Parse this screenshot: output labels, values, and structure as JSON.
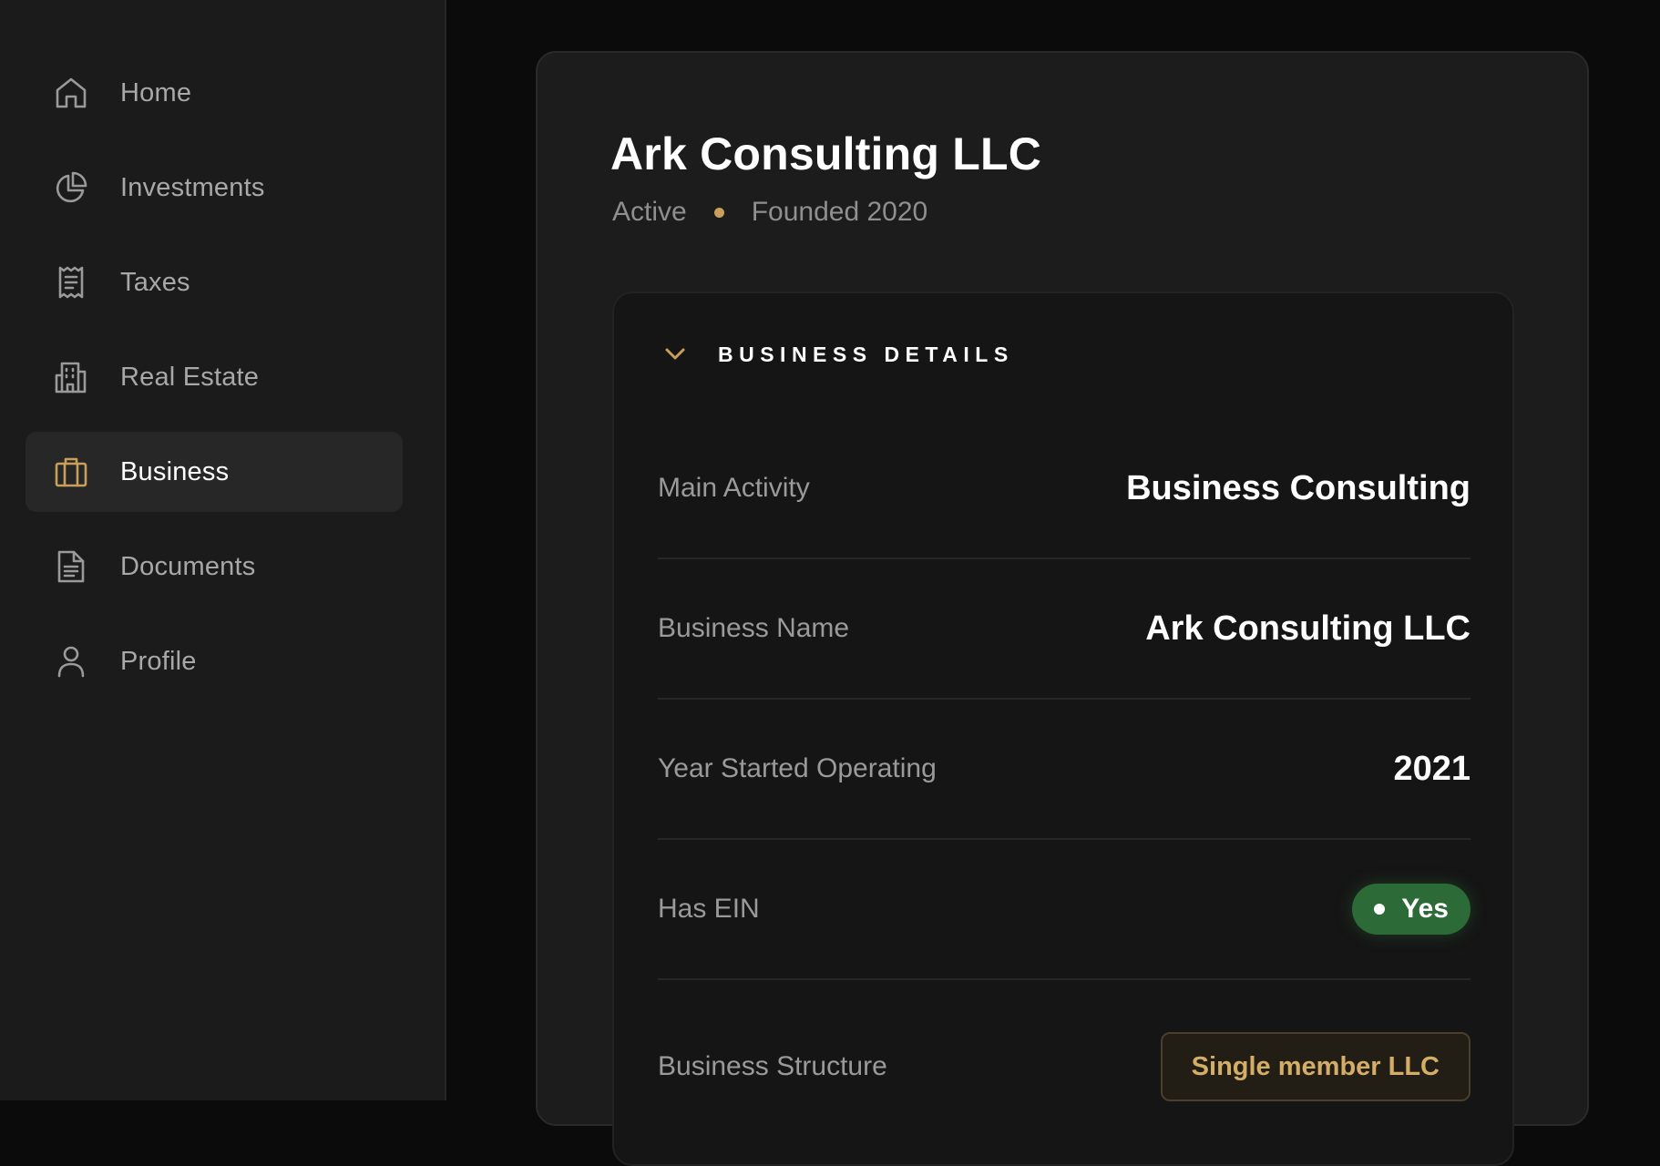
{
  "sidebar": {
    "items": [
      {
        "label": "Home",
        "icon": "home-icon",
        "active": false
      },
      {
        "label": "Investments",
        "icon": "pie-chart-icon",
        "active": false
      },
      {
        "label": "Taxes",
        "icon": "receipt-icon",
        "active": false
      },
      {
        "label": "Real Estate",
        "icon": "building-icon",
        "active": false
      },
      {
        "label": "Business",
        "icon": "briefcase-icon",
        "active": true
      },
      {
        "label": "Documents",
        "icon": "document-icon",
        "active": false
      },
      {
        "label": "Profile",
        "icon": "user-icon",
        "active": false
      }
    ]
  },
  "header": {
    "title": "Ark Consulting LLC",
    "status": "Active",
    "founded": "Founded 2020"
  },
  "section": {
    "title": "BUSINESS DETAILS",
    "rows": [
      {
        "label": "Main Activity",
        "value": "Business Consulting"
      },
      {
        "label": "Business Name",
        "value": "Ark Consulting LLC"
      },
      {
        "label": "Year Started Operating",
        "value": "2021"
      },
      {
        "label": "Has EIN",
        "value": "Yes"
      },
      {
        "label": "Business Structure",
        "value": "Single member LLC"
      }
    ]
  },
  "colors": {
    "accent": "#c8a05a",
    "success": "#2c6a38",
    "background": "#0b0b0b",
    "sidebar": "#1b1b1b",
    "card": "#1c1c1c"
  }
}
